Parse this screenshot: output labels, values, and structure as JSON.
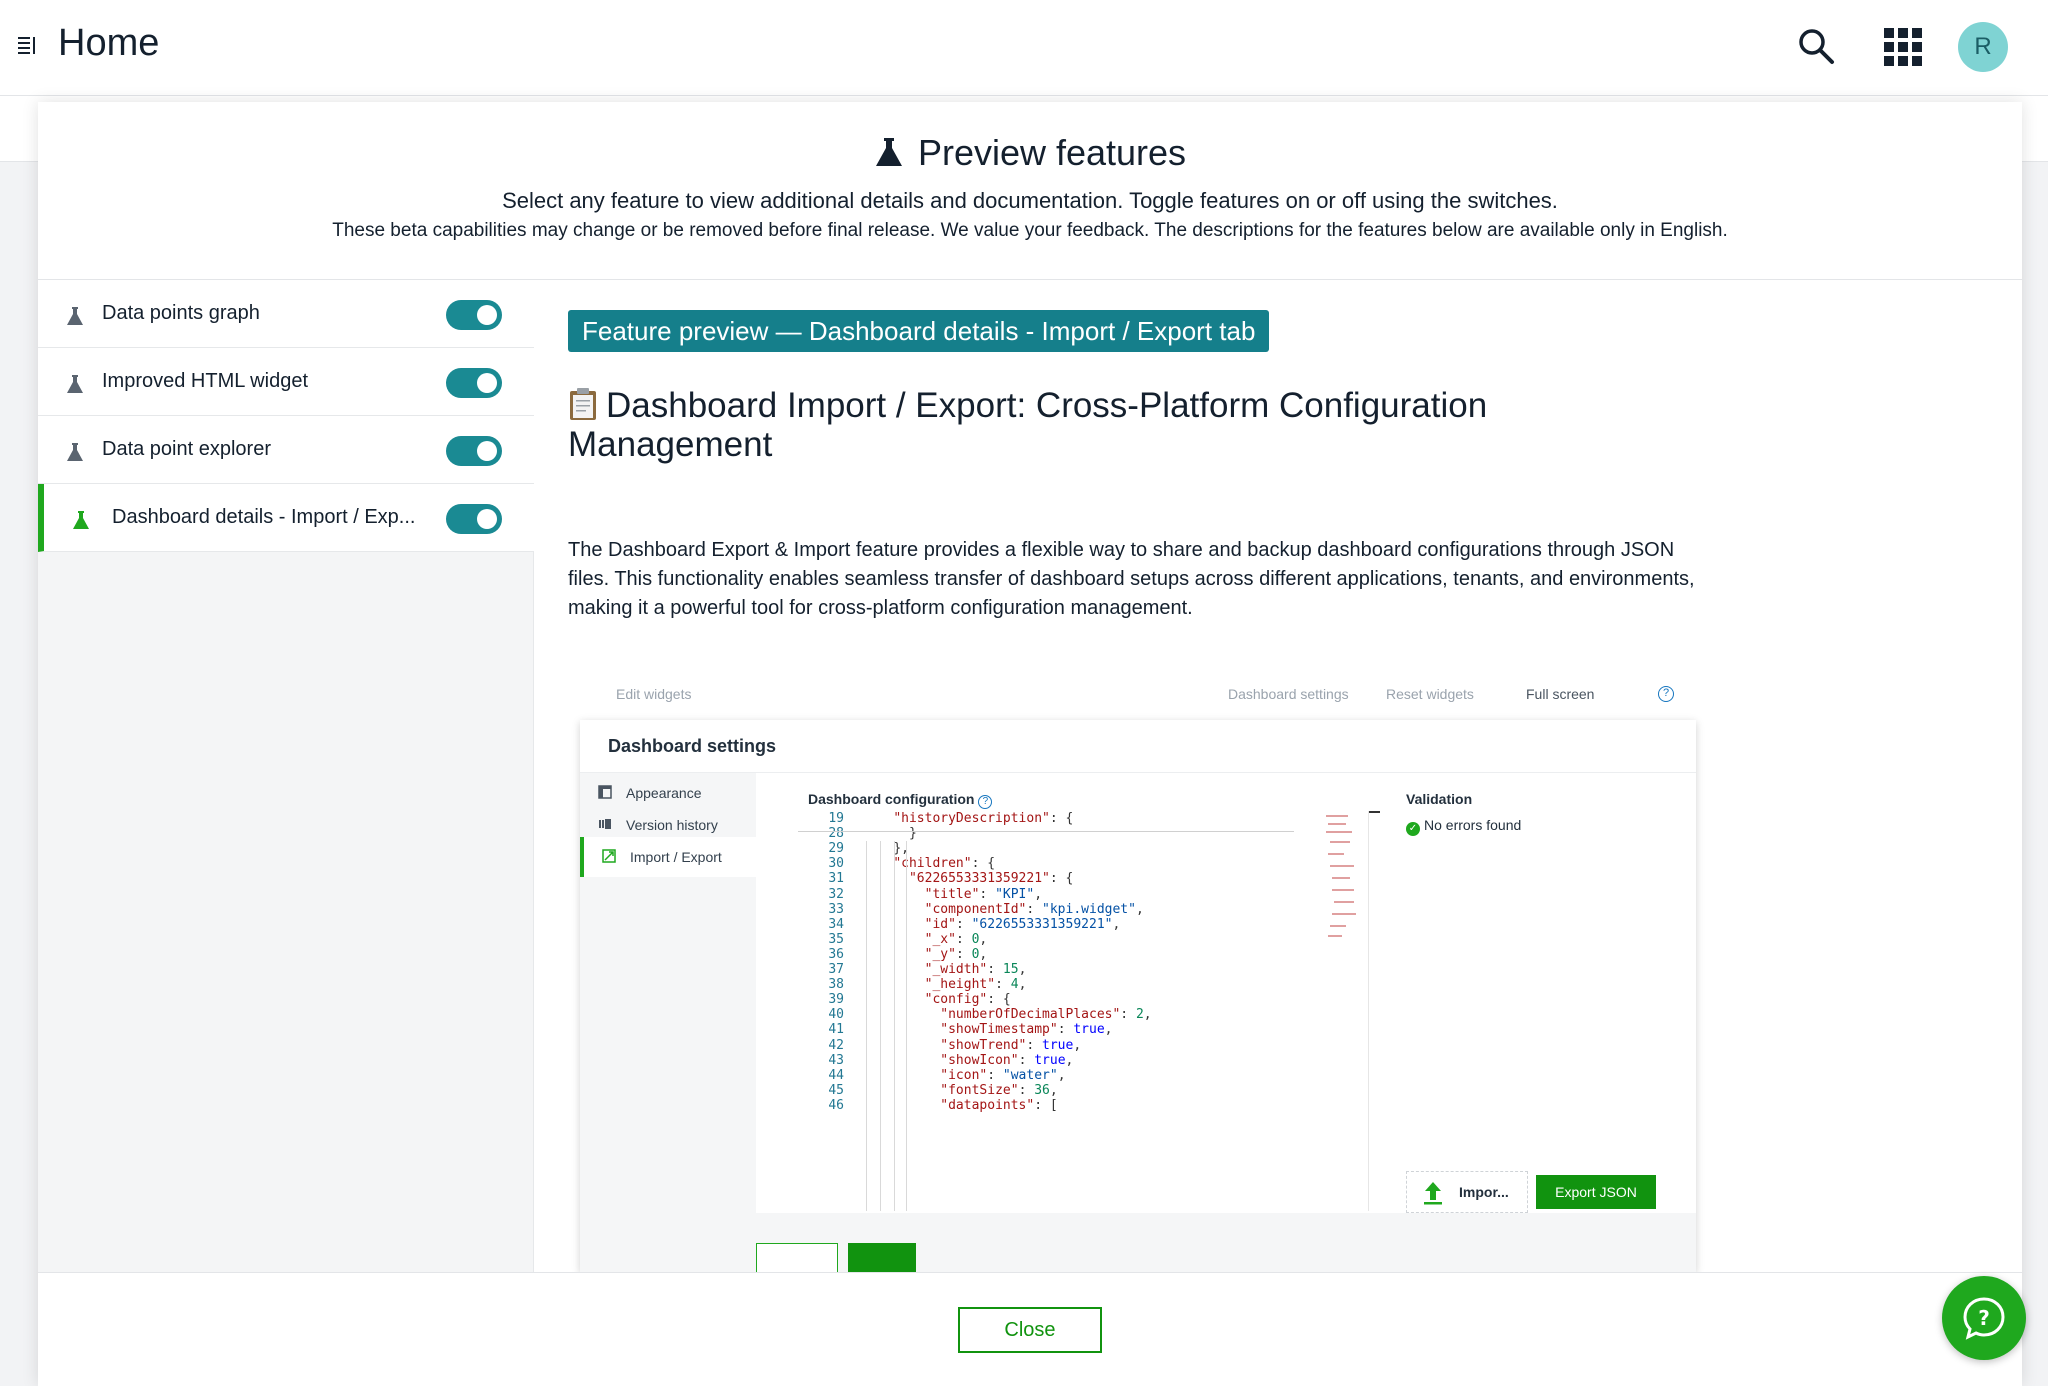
{
  "header": {
    "title": "Home",
    "avatar_initial": "R"
  },
  "modal": {
    "title": "Preview features",
    "subtitle": "Select any feature to view additional details and documentation. Toggle features on or off using the switches.",
    "note": "These beta capabilities may change or be removed before final release. We value your feedback. The descriptions for the features below are available only in English.",
    "close_label": "Close"
  },
  "features": [
    {
      "label": "Data points graph",
      "enabled": true,
      "active": false
    },
    {
      "label": "Improved HTML widget",
      "enabled": true,
      "active": false
    },
    {
      "label": "Data point explorer",
      "enabled": true,
      "active": false
    },
    {
      "label": "Dashboard details - Import / Exp...",
      "enabled": true,
      "active": true
    }
  ],
  "detail": {
    "badge": "Feature preview — Dashboard details - Import / Export tab",
    "title": "Dashboard Import / Export: Cross-Platform Configuration Management",
    "paragraph": "The Dashboard Export & Import feature provides a flexible way to share and backup dashboard configurations through JSON files. This functionality enables seamless transfer of dashboard setups across different applications, tenants, and environments, making it a powerful tool for cross-platform configuration management."
  },
  "screenshot": {
    "toolbar": {
      "edit_widgets": "Edit widgets",
      "dashboard_settings": "Dashboard settings",
      "reset_widgets": "Reset widgets",
      "full_screen": "Full screen",
      "help": "?"
    },
    "panel_title": "Dashboard settings",
    "nav": [
      "Appearance",
      "Version history",
      "Import / Export"
    ],
    "config_label": "Dashboard configuration",
    "validation_title": "Validation",
    "validation_value": "No errors found",
    "import_label": "Impor...",
    "export_label": "Export JSON",
    "code_lines": [
      {
        "n": "19",
        "t": "    \"historyDescription\": {"
      },
      {
        "n": "28",
        "t": "      }"
      },
      {
        "n": "29",
        "t": "    },"
      },
      {
        "n": "30",
        "t": "    \"children\": {"
      },
      {
        "n": "31",
        "t": "      \"6226553331359221\": {"
      },
      {
        "n": "32",
        "t": "        \"title\": \"KPI\","
      },
      {
        "n": "33",
        "t": "        \"componentId\": \"kpi.widget\","
      },
      {
        "n": "34",
        "t": "        \"id\": \"6226553331359221\","
      },
      {
        "n": "35",
        "t": "        \"_x\": 0,"
      },
      {
        "n": "36",
        "t": "        \"_y\": 0,"
      },
      {
        "n": "37",
        "t": "        \"_width\": 15,"
      },
      {
        "n": "38",
        "t": "        \"_height\": 4,"
      },
      {
        "n": "39",
        "t": "        \"config\": {"
      },
      {
        "n": "40",
        "t": "          \"numberOfDecimalPlaces\": 2,"
      },
      {
        "n": "41",
        "t": "          \"showTimestamp\": true,"
      },
      {
        "n": "42",
        "t": "          \"showTrend\": true,"
      },
      {
        "n": "43",
        "t": "          \"showIcon\": true,"
      },
      {
        "n": "44",
        "t": "          \"icon\": \"water\","
      },
      {
        "n": "45",
        "t": "          \"fontSize\": 36,"
      },
      {
        "n": "46",
        "t": "          \"datapoints\": ["
      }
    ]
  },
  "colors": {
    "accent": "#1fa81e",
    "toggle": "#1a8a93",
    "badge": "#157f8b"
  }
}
